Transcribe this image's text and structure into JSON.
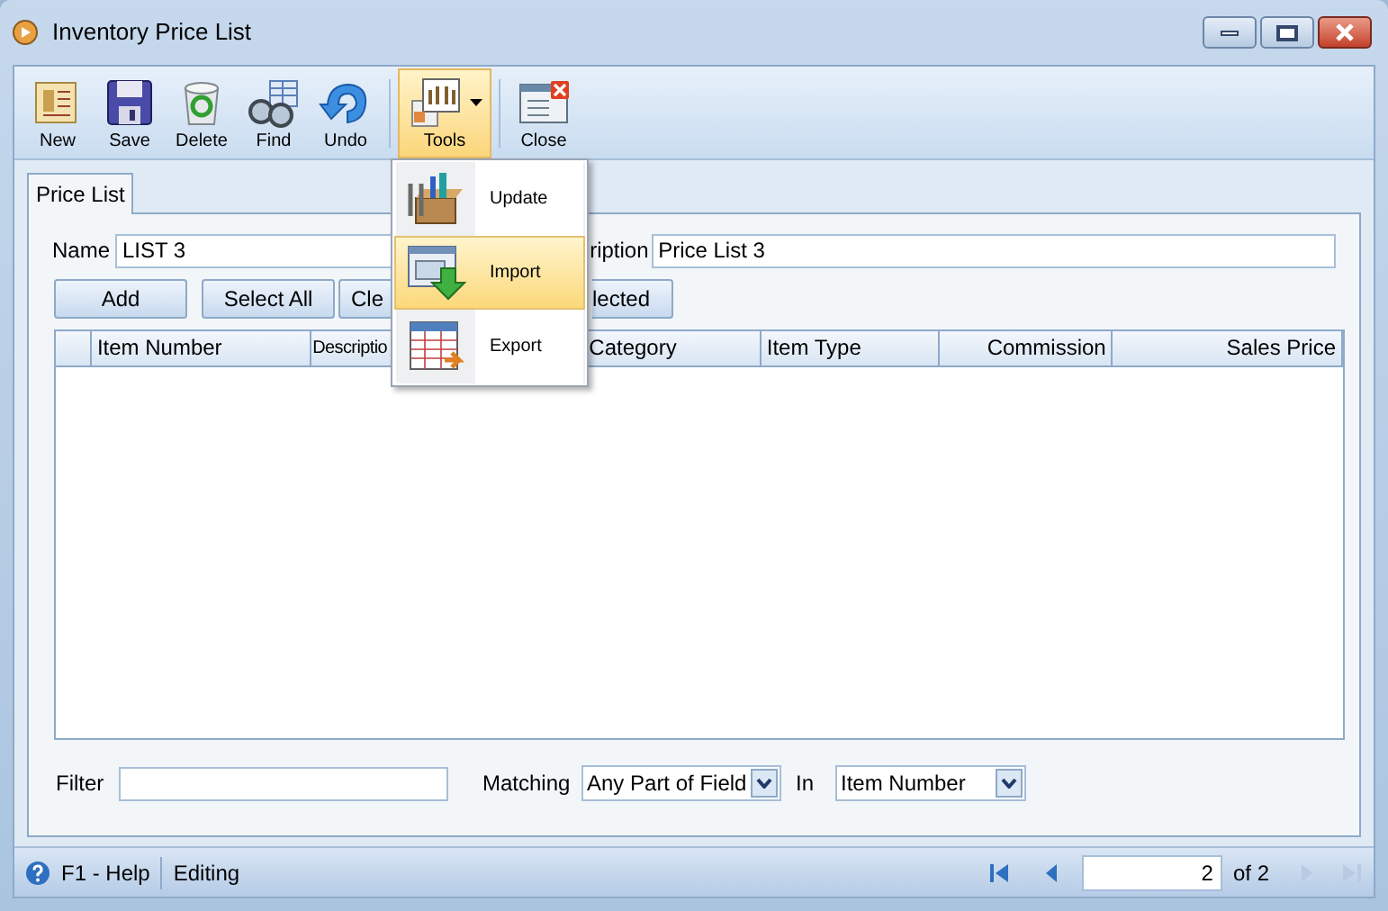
{
  "window": {
    "title": "Inventory Price List"
  },
  "toolbar": [
    {
      "label": "New",
      "kind": "new"
    },
    {
      "label": "Save",
      "kind": "save"
    },
    {
      "label": "Delete",
      "kind": "delete"
    },
    {
      "label": "Find",
      "kind": "find"
    },
    {
      "label": "Undo",
      "kind": "undo"
    },
    {
      "label": "Tools",
      "kind": "tools",
      "expanded": true
    },
    {
      "label": "Close",
      "kind": "close"
    }
  ],
  "tools_menu": [
    {
      "label": "Update",
      "kind": "update",
      "selected": false
    },
    {
      "label": "Import",
      "kind": "import",
      "selected": true
    },
    {
      "label": "Export",
      "kind": "export",
      "selected": false
    }
  ],
  "tabs": [
    {
      "label": "Price List",
      "selected": true
    }
  ],
  "form": {
    "name_label": "Name",
    "name_value": "LIST 3",
    "description_label": "ription",
    "description_value": "Price List 3"
  },
  "buttons": [
    "Add",
    "Select All",
    "Cle",
    "lected"
  ],
  "table": {
    "columns": [
      "Item Number",
      "Descriptio",
      "Category",
      "Item Type",
      "Commission",
      "Sales Price"
    ]
  },
  "filter": {
    "label": "Filter",
    "matching_label": "Matching",
    "matching_value": "Any Part of Field",
    "in_label": "In",
    "in_value": "Item Number"
  },
  "status_bar": {
    "help": "F1 - Help",
    "mode": "Editing",
    "page": "2",
    "of": "of 2"
  }
}
